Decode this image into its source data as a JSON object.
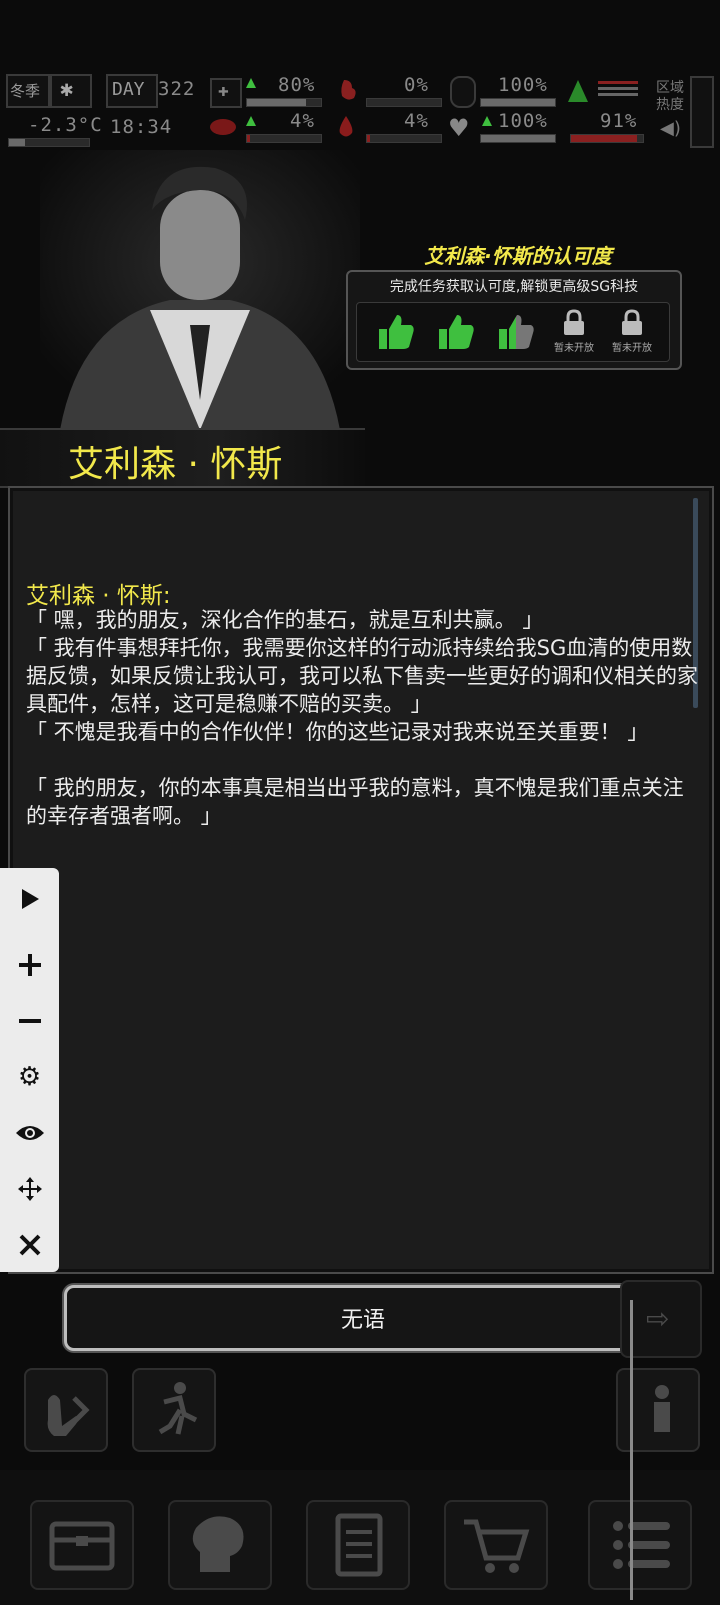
{
  "status": {
    "season": "冬季",
    "temperature": "-2.3°C",
    "day_label": "DAY",
    "day_number": "322",
    "time": "18:34",
    "health_pct": "80%",
    "hunger_pct": "0%",
    "stamina_pct": "100%",
    "stat4_pct": "4%",
    "stat5_pct": "4%",
    "mood_pct": "100%",
    "energy_pct": "91%",
    "zone_heat_label": "区域热度"
  },
  "character": {
    "name": "艾利森 · 怀斯"
  },
  "approval": {
    "title": "艾利森·怀斯的认可度",
    "subtitle": "完成任务获取认可度,解锁更高级SG科技",
    "levels": [
      {
        "state": "full",
        "icon": "thumbs-up-icon"
      },
      {
        "state": "full",
        "icon": "thumbs-up-icon"
      },
      {
        "state": "partial",
        "fill": 0.5,
        "icon": "thumbs-up-icon"
      },
      {
        "state": "locked",
        "label": "暂未开放",
        "icon": "lock-icon"
      },
      {
        "state": "locked",
        "label": "暂未开放",
        "icon": "lock-icon"
      }
    ]
  },
  "dialog": {
    "speaker": "艾利森 · 怀斯:",
    "lines": [
      "「 嘿，我的朋友，深化合作的基石，就是互利共赢。 」",
      "「 我有件事想拜托你，我需要你这样的行动派持续给我SG血清的使用数据反馈，如果反馈让我认可，我可以私下售卖一些更好的调和仪相关的家具配件，怎样，这可是稳赚不赔的买卖。 」",
      "「 不愧是我看中的合作伙伴！你的这些记录对我来说至关重要！ 」",
      "「 我的朋友，你的本事真是相当出乎我的意料，真不愧是我们重点关注的幸存者强者啊。 」"
    ]
  },
  "tool_panel": {
    "buttons": [
      "play-icon",
      "plus-icon",
      "minus-icon",
      "gear-icon",
      "eye-icon",
      "move-icon",
      "close-icon"
    ]
  },
  "reply": {
    "label": "无语"
  },
  "colors": {
    "accent_yellow": "#f2e84b",
    "thumb_green": "#3fbf3f"
  }
}
